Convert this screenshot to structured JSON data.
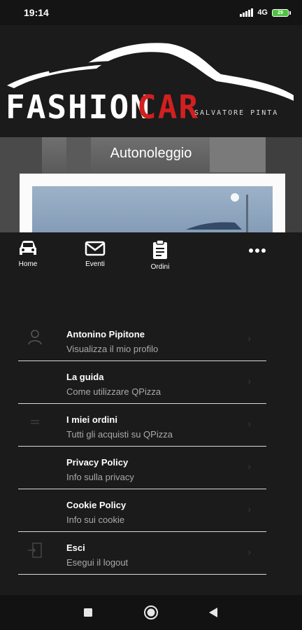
{
  "status_bar": {
    "time": "19:14",
    "network": "4G",
    "battery": "29"
  },
  "logo": {
    "word1": "FASHION",
    "word2": "CAR",
    "tagline": "SALVATORE PINTA"
  },
  "hero": {
    "title": "Autonoleggio"
  },
  "tabs": [
    {
      "label": "Home",
      "icon": "car-icon"
    },
    {
      "label": "Eventi",
      "icon": "envelope-icon"
    },
    {
      "label": "Ordini",
      "icon": "clipboard-icon"
    },
    {
      "label": "",
      "icon": "more-icon"
    }
  ],
  "menu": [
    {
      "title": "Antonino Pipitone",
      "subtitle": "Visualizza il mio profilo",
      "icon": "user-icon"
    },
    {
      "title": "La guida",
      "subtitle": "Come utilizzare QPizza",
      "icon": ""
    },
    {
      "title": "I miei ordini",
      "subtitle": "Tutti gli acquisti su QPizza",
      "icon": "list-icon"
    },
    {
      "title": "Privacy Policy",
      "subtitle": "Info sulla privacy",
      "icon": ""
    },
    {
      "title": "Cookie Policy",
      "subtitle": "Info sui cookie",
      "icon": ""
    },
    {
      "title": "Esci",
      "subtitle": "Esegui il logout",
      "icon": "logout-icon"
    }
  ],
  "colors": {
    "brand_red": "#d21f1f",
    "background": "#1b1b1b",
    "divider": "#d9d9d9",
    "subtitle": "#a9a9a9"
  }
}
